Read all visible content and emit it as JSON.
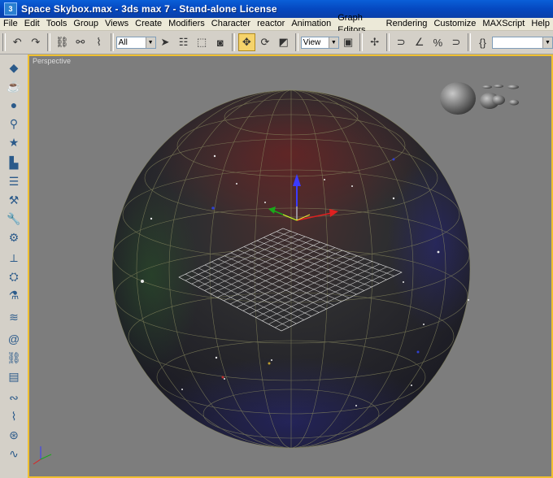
{
  "window": {
    "title": "Space Skybox.max - 3ds max 7 - Stand-alone License"
  },
  "menu": [
    "File",
    "Edit",
    "Tools",
    "Group",
    "Views",
    "Create",
    "Modifiers",
    "Character",
    "reactor",
    "Animation",
    "Graph Editors",
    "Rendering",
    "Customize",
    "MAXScript",
    "Help"
  ],
  "toolbar": {
    "selection_filter": "All",
    "reference_coord": "View"
  },
  "viewport": {
    "label": "Perspective"
  },
  "colors": {
    "accent": "#f0c030",
    "titlebar": "#0548c0"
  },
  "icons": {
    "undo": "undo-icon",
    "redo": "redo-icon",
    "select": "select-arrow-icon",
    "move": "move-icon",
    "rotate": "rotate-icon",
    "scale": "scale-icon"
  }
}
